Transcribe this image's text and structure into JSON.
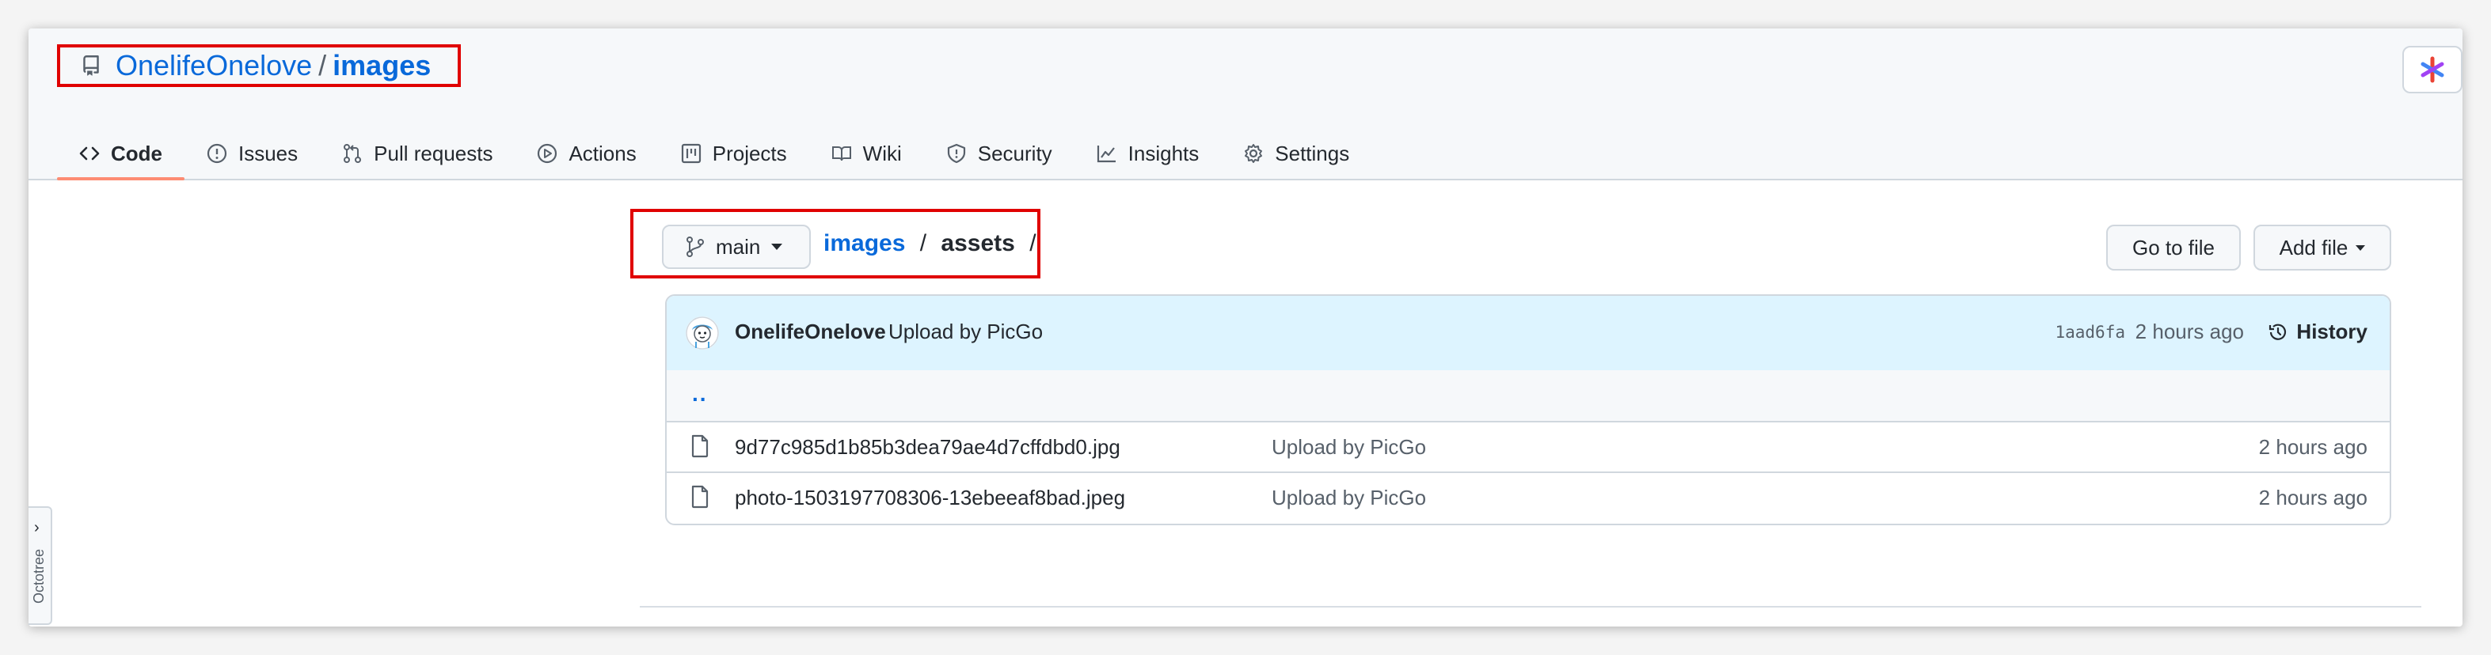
{
  "repo": {
    "owner": "OnelifeOnelove",
    "separator": "/",
    "name": "images"
  },
  "nav_tabs": [
    {
      "label": "Code",
      "active": true,
      "icon": "code-icon"
    },
    {
      "label": "Issues",
      "icon": "issue-icon"
    },
    {
      "label": "Pull requests",
      "icon": "pull-request-icon"
    },
    {
      "label": "Actions",
      "icon": "play-icon"
    },
    {
      "label": "Projects",
      "icon": "project-icon"
    },
    {
      "label": "Wiki",
      "icon": "book-icon"
    },
    {
      "label": "Security",
      "icon": "shield-icon"
    },
    {
      "label": "Insights",
      "icon": "graph-icon"
    },
    {
      "label": "Settings",
      "icon": "gear-icon"
    }
  ],
  "branch": {
    "label": "main"
  },
  "path": {
    "root": "images",
    "sep1": "/",
    "folder": "assets",
    "sep2": "/"
  },
  "actions": {
    "go_to_file": "Go to file",
    "add_file": "Add file"
  },
  "commit": {
    "author": "OnelifeOnelove",
    "message": "Upload by PicGo",
    "sha": "1aad6fa",
    "time": "2 hours ago",
    "history_label": "History"
  },
  "parent_dir": "..",
  "files": [
    {
      "name": "9d77c985d1b85b3dea79ae4d7cffdbd0.jpg",
      "message": "Upload by PicGo",
      "age": "2 hours ago"
    },
    {
      "name": "photo-1503197708306-13ebeeaf8bad.jpeg",
      "message": "Upload by PicGo",
      "age": "2 hours ago"
    }
  ],
  "octotree": {
    "chevron": "›",
    "label": "Octotree"
  },
  "colors": {
    "accent": "#0969da",
    "highlight": "#e00000",
    "tab_underline": "#fd8c73"
  }
}
